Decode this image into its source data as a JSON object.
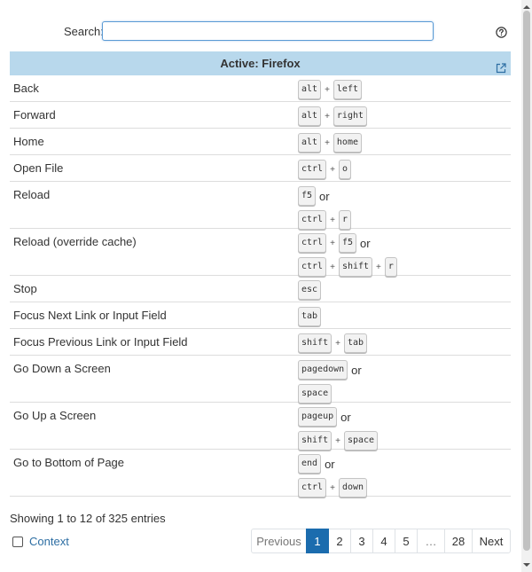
{
  "search": {
    "label": "Search:",
    "value": "",
    "placeholder": ""
  },
  "help_icon": "question-circle-icon",
  "header": {
    "title": "Active: Firefox",
    "icon": "external-link-icon",
    "background": "#b8d8ec"
  },
  "shortcuts": [
    {
      "name": "Back",
      "combos": [
        [
          "alt",
          "left"
        ]
      ]
    },
    {
      "name": "Forward",
      "combos": [
        [
          "alt",
          "right"
        ]
      ]
    },
    {
      "name": "Home",
      "combos": [
        [
          "alt",
          "home"
        ]
      ]
    },
    {
      "name": "Open File",
      "combos": [
        [
          "ctrl",
          "o"
        ]
      ]
    },
    {
      "name": "Reload",
      "combos": [
        [
          "f5"
        ],
        [
          "ctrl",
          "r"
        ]
      ]
    },
    {
      "name": "Reload (override cache)",
      "combos": [
        [
          "ctrl",
          "f5"
        ],
        [
          "ctrl",
          "shift",
          "r"
        ]
      ]
    },
    {
      "name": "Stop",
      "combos": [
        [
          "esc"
        ]
      ]
    },
    {
      "name": "Focus Next Link or Input Field",
      "combos": [
        [
          "tab"
        ]
      ]
    },
    {
      "name": "Focus Previous Link or Input Field",
      "combos": [
        [
          "shift",
          "tab"
        ]
      ]
    },
    {
      "name": "Go Down a Screen",
      "combos": [
        [
          "pagedown"
        ],
        [
          "space"
        ]
      ]
    },
    {
      "name": "Go Up a Screen",
      "combos": [
        [
          "pageup"
        ],
        [
          "shift",
          "space"
        ]
      ]
    },
    {
      "name": "Go to Bottom of Page",
      "combos": [
        [
          "end"
        ],
        [
          "ctrl",
          "down"
        ]
      ]
    }
  ],
  "separators": {
    "plus": "+",
    "or": "or"
  },
  "footer": {
    "entries_info": "Showing 1 to 12 of 325 entries",
    "context_label": "Context",
    "context_checked": false
  },
  "pagination": [
    {
      "label": "Previous",
      "state": "disabled"
    },
    {
      "label": "1",
      "state": "active"
    },
    {
      "label": "2",
      "state": "normal"
    },
    {
      "label": "3",
      "state": "normal"
    },
    {
      "label": "4",
      "state": "normal"
    },
    {
      "label": "5",
      "state": "normal"
    },
    {
      "label": "…",
      "state": "disabled"
    },
    {
      "label": "28",
      "state": "normal"
    },
    {
      "label": "Next",
      "state": "normal"
    }
  ],
  "colors": {
    "accent": "#1b6cae",
    "link": "#2d6ea3",
    "search_border": "#5b9bd5"
  }
}
